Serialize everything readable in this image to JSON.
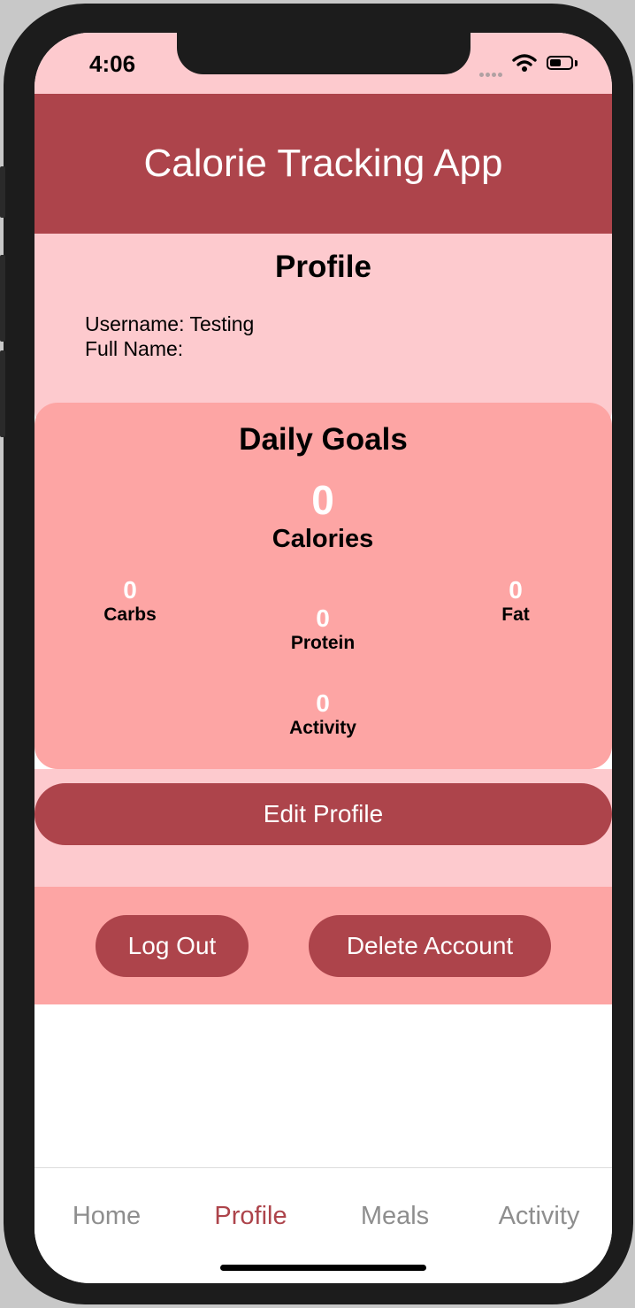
{
  "status_bar": {
    "time": "4:06"
  },
  "header": {
    "title": "Calorie Tracking App"
  },
  "profile": {
    "heading": "Profile",
    "username_line": "Username: Testing",
    "fullname_line": "Full Name:"
  },
  "daily_goals": {
    "heading": "Daily Goals",
    "calories": {
      "value": "0",
      "label": "Calories"
    },
    "carbs": {
      "value": "0",
      "label": "Carbs"
    },
    "protein": {
      "value": "0",
      "label": "Protein"
    },
    "fat": {
      "value": "0",
      "label": "Fat"
    },
    "activity": {
      "value": "0",
      "label": "Activity"
    }
  },
  "buttons": {
    "edit_profile": "Edit Profile",
    "log_out": "Log Out",
    "delete_account": "Delete Account"
  },
  "tabs": [
    {
      "label": "Home",
      "active": false
    },
    {
      "label": "Profile",
      "active": true
    },
    {
      "label": "Meals",
      "active": false
    },
    {
      "label": "Activity",
      "active": false
    }
  ],
  "colors": {
    "accent": "#ad444b",
    "light_pink": "#fdcace",
    "salmon": "#fda5a4",
    "inactive_tab": "#8e8e8e"
  }
}
